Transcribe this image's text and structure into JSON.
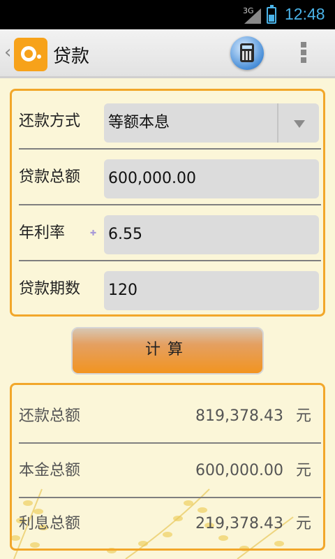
{
  "status_bar": {
    "network": "3G",
    "time": "12:48"
  },
  "action_bar": {
    "title": "贷款",
    "back_icon": "chevron-left-icon",
    "app_icon": "app-logo-icon",
    "calculator_icon": "calculator-icon",
    "overflow_icon": "overflow-menu-icon"
  },
  "form": {
    "repayment_method": {
      "label": "还款方式",
      "value": "等额本息"
    },
    "loan_amount": {
      "label": "贷款总额",
      "value": "600,000.00"
    },
    "annual_rate": {
      "label": "年利率",
      "value": "6.55"
    },
    "loan_term": {
      "label": "贷款期数",
      "value": "120"
    }
  },
  "calculate_button": {
    "label": "计算"
  },
  "results": [
    {
      "label": "还款总额",
      "value": "819,378.43",
      "unit": "元"
    },
    {
      "label": "本金总额",
      "value": "600,000.00",
      "unit": "元"
    },
    {
      "label": "利息总额",
      "value": "219,378.43",
      "unit": "元"
    }
  ],
  "colors": {
    "accent": "#f2a72a",
    "background": "#fbf6d8",
    "status_accent": "#4ab3e8"
  }
}
